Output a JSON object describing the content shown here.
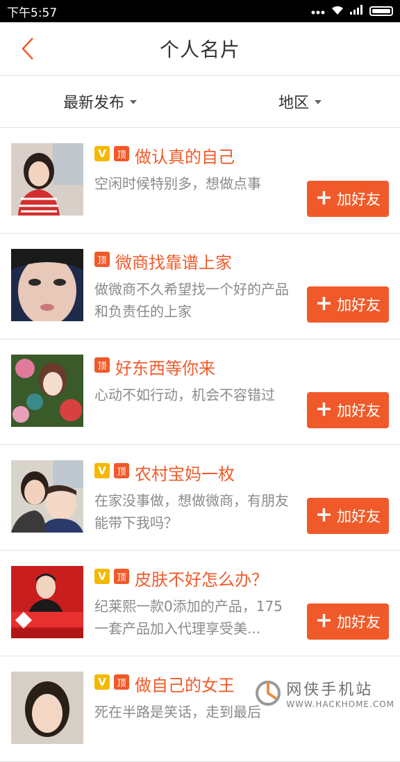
{
  "status": {
    "time": "下午5:57"
  },
  "header": {
    "title": "个人名片"
  },
  "filters": [
    {
      "label": "最新发布"
    },
    {
      "label": "地区"
    }
  ],
  "items": [
    {
      "title": "做认真的自己",
      "desc": "空闲时候特别多，想做点事",
      "v": true,
      "top": true,
      "button": "加好友"
    },
    {
      "title": "微商找靠谱上家",
      "desc": "做微商不久希望找一个好的产品和负责任的上家",
      "v": false,
      "top": true,
      "button": "加好友"
    },
    {
      "title": "好东西等你来",
      "desc": "心动不如行动，机会不容错过",
      "v": false,
      "top": true,
      "button": "加好友"
    },
    {
      "title": "农村宝妈一枚",
      "desc": "在家没事做，想做微商，有朋友能带下我吗？",
      "v": true,
      "top": true,
      "button": "加好友"
    },
    {
      "title": "皮肤不好怎么办？",
      "desc": "纪莱熙一款0添加的产品，175一套产品加入代理享受美...",
      "v": true,
      "top": true,
      "button": "加好友"
    },
    {
      "title": "做自己的女王",
      "desc": "死在半路是笑话，走到最后",
      "v": true,
      "top": true,
      "button": "加好友"
    }
  ],
  "badges": {
    "v": "V",
    "top": "顶"
  },
  "watermark": {
    "title": "网侠手机站",
    "url": "WWW.HACKHOME.COM"
  },
  "colors": {
    "accent": "#f05a2a",
    "vip": "#f5b800"
  }
}
